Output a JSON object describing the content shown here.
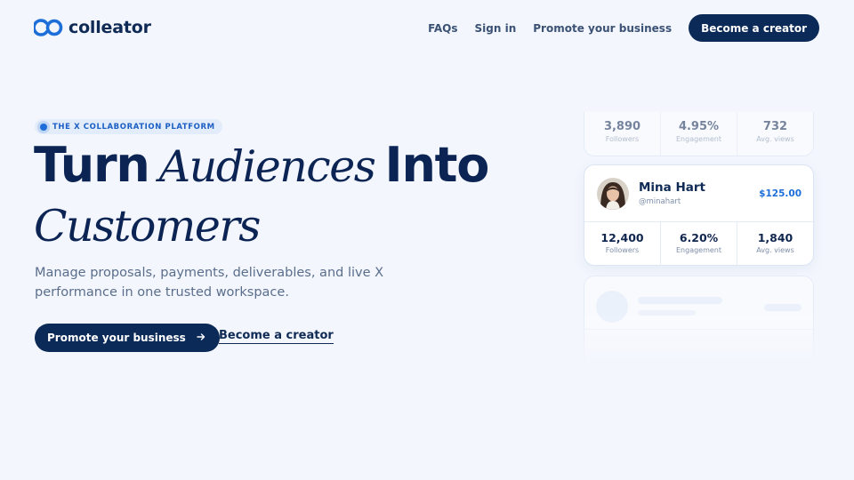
{
  "brand": {
    "name": "colleator",
    "accent": "#1d6ed8",
    "navy": "#0b2a57"
  },
  "nav": {
    "links": [
      "FAQs",
      "Sign in",
      "Promote your business"
    ],
    "cta": "Become a creator"
  },
  "hero": {
    "badge": "THE X COLLABORATION PLATFORM",
    "headline": {
      "part1": "Turn",
      "part2": "Audiences",
      "part3": "Into",
      "part4": "Customers"
    },
    "subtitle": "Manage proposals, payments, deliverables, and live X performance in one trusted workspace.",
    "primary_button": "Promote your business",
    "secondary_link": "Become a creator"
  },
  "cards": {
    "top": {
      "stats": [
        {
          "value": "3,890",
          "label": "Followers"
        },
        {
          "value": "4.95%",
          "label": "Engagement"
        },
        {
          "value": "732",
          "label": "Avg. views"
        }
      ]
    },
    "main": {
      "name": "Mina Hart",
      "handle": "@minahart",
      "price": "$125.00",
      "stats": [
        {
          "value": "12,400",
          "label": "Followers"
        },
        {
          "value": "6.20%",
          "label": "Engagement"
        },
        {
          "value": "1,840",
          "label": "Avg. views"
        }
      ]
    }
  },
  "icons": {
    "logo": "co-logo-icon",
    "arrow": "arrow-right-icon"
  }
}
